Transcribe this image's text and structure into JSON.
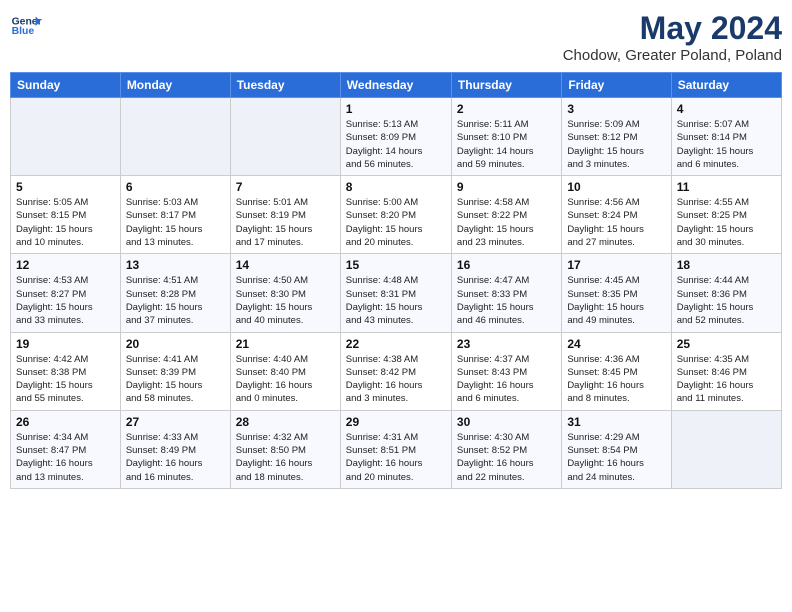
{
  "header": {
    "logo_line1": "General",
    "logo_line2": "Blue",
    "month_year": "May 2024",
    "location": "Chodow, Greater Poland, Poland"
  },
  "weekdays": [
    "Sunday",
    "Monday",
    "Tuesday",
    "Wednesday",
    "Thursday",
    "Friday",
    "Saturday"
  ],
  "weeks": [
    [
      {
        "day": "",
        "content": ""
      },
      {
        "day": "",
        "content": ""
      },
      {
        "day": "",
        "content": ""
      },
      {
        "day": "1",
        "content": "Sunrise: 5:13 AM\nSunset: 8:09 PM\nDaylight: 14 hours\nand 56 minutes."
      },
      {
        "day": "2",
        "content": "Sunrise: 5:11 AM\nSunset: 8:10 PM\nDaylight: 14 hours\nand 59 minutes."
      },
      {
        "day": "3",
        "content": "Sunrise: 5:09 AM\nSunset: 8:12 PM\nDaylight: 15 hours\nand 3 minutes."
      },
      {
        "day": "4",
        "content": "Sunrise: 5:07 AM\nSunset: 8:14 PM\nDaylight: 15 hours\nand 6 minutes."
      }
    ],
    [
      {
        "day": "5",
        "content": "Sunrise: 5:05 AM\nSunset: 8:15 PM\nDaylight: 15 hours\nand 10 minutes."
      },
      {
        "day": "6",
        "content": "Sunrise: 5:03 AM\nSunset: 8:17 PM\nDaylight: 15 hours\nand 13 minutes."
      },
      {
        "day": "7",
        "content": "Sunrise: 5:01 AM\nSunset: 8:19 PM\nDaylight: 15 hours\nand 17 minutes."
      },
      {
        "day": "8",
        "content": "Sunrise: 5:00 AM\nSunset: 8:20 PM\nDaylight: 15 hours\nand 20 minutes."
      },
      {
        "day": "9",
        "content": "Sunrise: 4:58 AM\nSunset: 8:22 PM\nDaylight: 15 hours\nand 23 minutes."
      },
      {
        "day": "10",
        "content": "Sunrise: 4:56 AM\nSunset: 8:24 PM\nDaylight: 15 hours\nand 27 minutes."
      },
      {
        "day": "11",
        "content": "Sunrise: 4:55 AM\nSunset: 8:25 PM\nDaylight: 15 hours\nand 30 minutes."
      }
    ],
    [
      {
        "day": "12",
        "content": "Sunrise: 4:53 AM\nSunset: 8:27 PM\nDaylight: 15 hours\nand 33 minutes."
      },
      {
        "day": "13",
        "content": "Sunrise: 4:51 AM\nSunset: 8:28 PM\nDaylight: 15 hours\nand 37 minutes."
      },
      {
        "day": "14",
        "content": "Sunrise: 4:50 AM\nSunset: 8:30 PM\nDaylight: 15 hours\nand 40 minutes."
      },
      {
        "day": "15",
        "content": "Sunrise: 4:48 AM\nSunset: 8:31 PM\nDaylight: 15 hours\nand 43 minutes."
      },
      {
        "day": "16",
        "content": "Sunrise: 4:47 AM\nSunset: 8:33 PM\nDaylight: 15 hours\nand 46 minutes."
      },
      {
        "day": "17",
        "content": "Sunrise: 4:45 AM\nSunset: 8:35 PM\nDaylight: 15 hours\nand 49 minutes."
      },
      {
        "day": "18",
        "content": "Sunrise: 4:44 AM\nSunset: 8:36 PM\nDaylight: 15 hours\nand 52 minutes."
      }
    ],
    [
      {
        "day": "19",
        "content": "Sunrise: 4:42 AM\nSunset: 8:38 PM\nDaylight: 15 hours\nand 55 minutes."
      },
      {
        "day": "20",
        "content": "Sunrise: 4:41 AM\nSunset: 8:39 PM\nDaylight: 15 hours\nand 58 minutes."
      },
      {
        "day": "21",
        "content": "Sunrise: 4:40 AM\nSunset: 8:40 PM\nDaylight: 16 hours\nand 0 minutes."
      },
      {
        "day": "22",
        "content": "Sunrise: 4:38 AM\nSunset: 8:42 PM\nDaylight: 16 hours\nand 3 minutes."
      },
      {
        "day": "23",
        "content": "Sunrise: 4:37 AM\nSunset: 8:43 PM\nDaylight: 16 hours\nand 6 minutes."
      },
      {
        "day": "24",
        "content": "Sunrise: 4:36 AM\nSunset: 8:45 PM\nDaylight: 16 hours\nand 8 minutes."
      },
      {
        "day": "25",
        "content": "Sunrise: 4:35 AM\nSunset: 8:46 PM\nDaylight: 16 hours\nand 11 minutes."
      }
    ],
    [
      {
        "day": "26",
        "content": "Sunrise: 4:34 AM\nSunset: 8:47 PM\nDaylight: 16 hours\nand 13 minutes."
      },
      {
        "day": "27",
        "content": "Sunrise: 4:33 AM\nSunset: 8:49 PM\nDaylight: 16 hours\nand 16 minutes."
      },
      {
        "day": "28",
        "content": "Sunrise: 4:32 AM\nSunset: 8:50 PM\nDaylight: 16 hours\nand 18 minutes."
      },
      {
        "day": "29",
        "content": "Sunrise: 4:31 AM\nSunset: 8:51 PM\nDaylight: 16 hours\nand 20 minutes."
      },
      {
        "day": "30",
        "content": "Sunrise: 4:30 AM\nSunset: 8:52 PM\nDaylight: 16 hours\nand 22 minutes."
      },
      {
        "day": "31",
        "content": "Sunrise: 4:29 AM\nSunset: 8:54 PM\nDaylight: 16 hours\nand 24 minutes."
      },
      {
        "day": "",
        "content": ""
      }
    ]
  ]
}
